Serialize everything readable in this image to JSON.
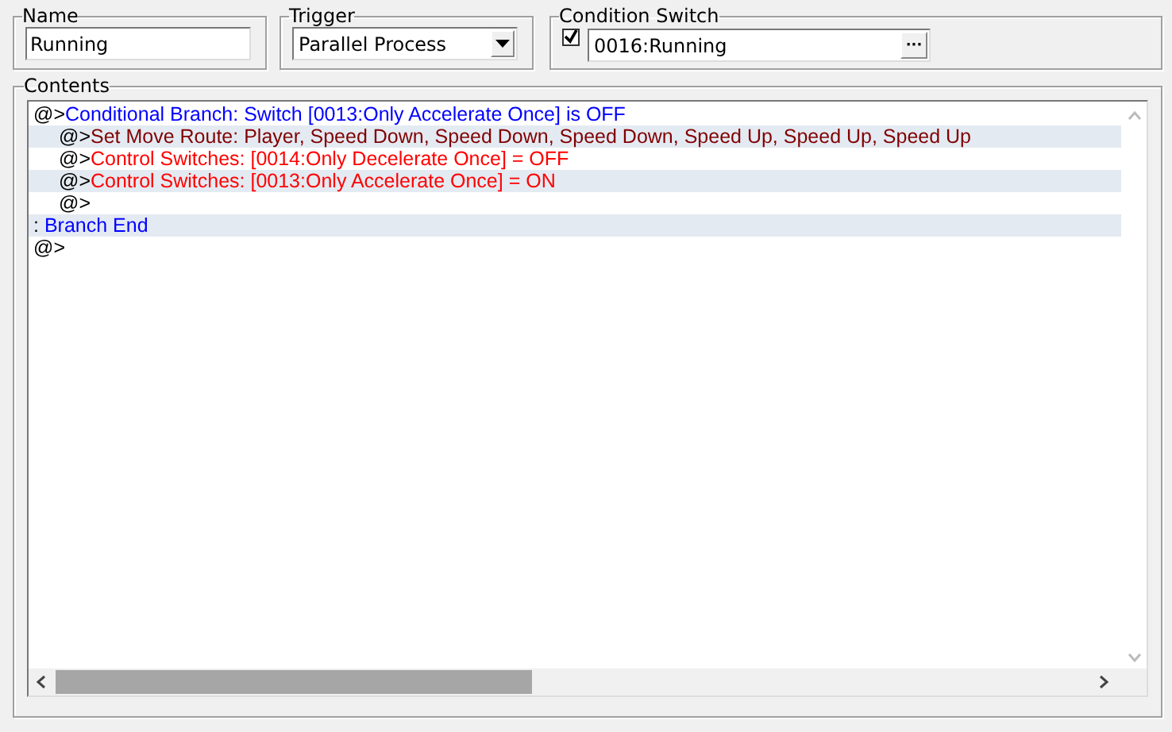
{
  "name": {
    "label": "Name",
    "value": "Running"
  },
  "trigger": {
    "label": "Trigger",
    "value": "Parallel Process"
  },
  "condition_switch": {
    "label": "Condition Switch",
    "checked": true,
    "value": "0016:Running",
    "button": "···"
  },
  "contents": {
    "label": "Contents",
    "commands": [
      {
        "kind": "branch",
        "prefix": "@>",
        "text": "Conditional Branch: Switch [0013:Only Accelerate Once] is OFF",
        "children": [
          {
            "kind": "move",
            "prefix": "@>",
            "text": "Set Move Route: Player, Speed Down, Speed Down, Speed Down, Speed Up, Speed Up, Speed Up"
          },
          {
            "kind": "switch",
            "prefix": "@>",
            "text": "Control Switches: [0014:Only Decelerate Once] = OFF"
          },
          {
            "kind": "switch",
            "prefix": "@>",
            "text": "Control Switches: [0013:Only Accelerate Once] = ON"
          },
          {
            "prefix": "@>"
          }
        ]
      },
      {
        "kind": "end",
        "prefix": ":",
        "text": "Branch End"
      },
      {
        "prefix": "@>"
      }
    ]
  }
}
